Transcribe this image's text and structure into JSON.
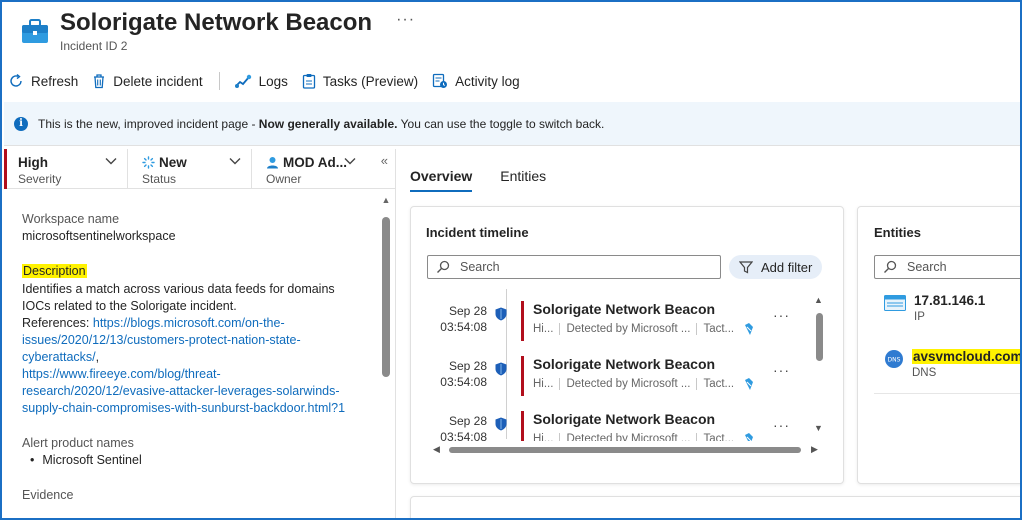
{
  "header": {
    "title": "Solorigate Network Beacon",
    "subtitle": "Incident ID 2",
    "more": "···"
  },
  "toolbar": {
    "refresh": "Refresh",
    "delete": "Delete incident",
    "logs": "Logs",
    "tasks": "Tasks (Preview)",
    "activity": "Activity log"
  },
  "banner": {
    "prefix": "This is the new, improved incident page - ",
    "bold": "Now generally available.",
    "suffix": " You can use the toggle to switch back."
  },
  "properties": {
    "severity": {
      "value": "High",
      "label": "Severity",
      "color": "#b10e1c"
    },
    "status": {
      "value": "New",
      "label": "Status"
    },
    "owner": {
      "value": "MOD Ad...",
      "label": "Owner"
    }
  },
  "details": {
    "workspace_label": "Workspace name",
    "workspace_value": "microsoftsentinelworkspace",
    "description_label": "Description",
    "description_line1": "Identifies a match across various data feeds for domains",
    "description_line2": "IOCs related to the Solorigate incident.",
    "references_label": "References: ",
    "link1_a": "https://blogs.microsoft.com/on-the-",
    "link1_b": "issues/2020/12/13/customers-protect-nation-state-",
    "link1_c": "cyberattacks/",
    "link1_comma": ",",
    "link2_a": "https://www.fireeye.com/blog/threat-",
    "link2_b": "research/2020/12/evasive-attacker-leverages-solarwinds-",
    "link2_c": "supply-chain-compromises-with-sunburst-backdoor.html?1",
    "alert_products_label": "Alert product names",
    "alert_products": [
      "Microsoft Sentinel"
    ],
    "evidence_label": "Evidence"
  },
  "tabs": [
    {
      "label": "Overview",
      "active": true
    },
    {
      "label": "Entities",
      "active": false
    }
  ],
  "timeline": {
    "title": "Incident timeline",
    "search_placeholder": "Search",
    "add_filter": "Add filter",
    "items": [
      {
        "date": "Sep 28",
        "time": "03:54:08",
        "name": "Solorigate Network Beacon",
        "sev": "Hi...",
        "detected": "Detected by Microsoft ...",
        "tactic": "Tact..."
      },
      {
        "date": "Sep 28",
        "time": "03:54:08",
        "name": "Solorigate Network Beacon",
        "sev": "Hi...",
        "detected": "Detected by Microsoft ...",
        "tactic": "Tact..."
      },
      {
        "date": "Sep 28",
        "time": "03:54:08",
        "name": "Solorigate Network Beacon",
        "sev": "Hi...",
        "detected": "Detected by Microsoft ...",
        "tactic": "Tact..."
      }
    ]
  },
  "entities": {
    "title": "Entities",
    "search_placeholder": "Search",
    "items": [
      {
        "value": "17.81.146.1",
        "type": "IP",
        "highlighted": false
      },
      {
        "value": "avsvmcloud.com",
        "type": "DNS",
        "highlighted": true
      }
    ]
  },
  "colors": {
    "accent": "#0f6cbd",
    "severity_high": "#b10e1c",
    "highlight": "#fff200",
    "banner_bg": "#eff6fc"
  }
}
